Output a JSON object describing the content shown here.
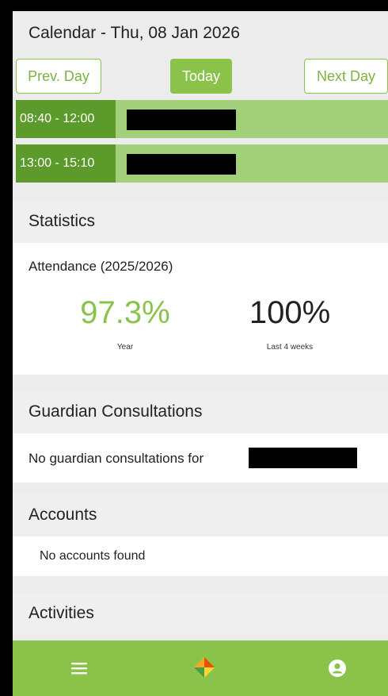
{
  "calendar": {
    "title": "Calendar - Thu, 08 Jan 2026",
    "prev_label": "Prev. Day",
    "today_label": "Today",
    "next_label": "Next Day",
    "lessons": [
      {
        "time": "08:40 - 12:00"
      },
      {
        "time": "13:00 - 15:10"
      }
    ]
  },
  "statistics": {
    "heading": "Statistics",
    "attendance_label": "Attendance (2025/2026)",
    "year_value": "97.3%",
    "year_caption": "Year",
    "recent_value": "100%",
    "recent_caption": "Last 4 weeks"
  },
  "guardian": {
    "heading": "Guardian Consultations",
    "message": "No guardian consultations for"
  },
  "accounts": {
    "heading": "Accounts",
    "message": "No accounts found"
  },
  "activities": {
    "heading": "Activities"
  },
  "nav": {
    "items": [
      "menu-icon",
      "home-logo-icon",
      "user-profile-icon"
    ]
  },
  "colors": {
    "accent": "#8bc34a",
    "lesson_time_bg": "#5d9a2c",
    "lesson_bg": "#a2cf7a"
  }
}
